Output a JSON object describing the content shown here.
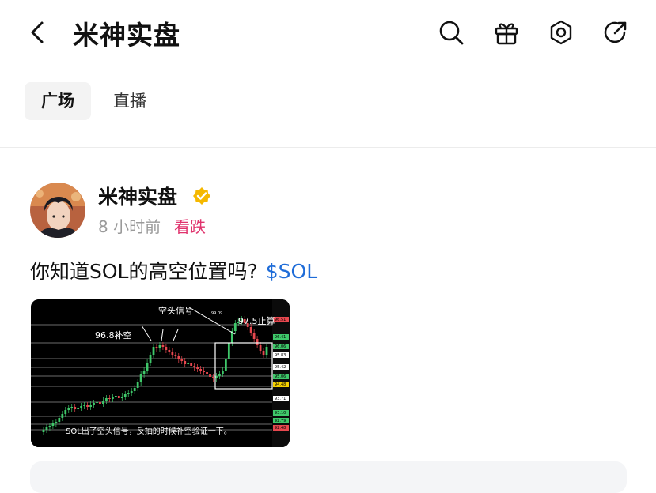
{
  "header": {
    "title": "米神实盘",
    "icons": [
      "back-arrow-icon",
      "search-icon",
      "gift-icon",
      "settings-hexagon-icon",
      "share-icon"
    ]
  },
  "tabs": [
    {
      "label": "广场",
      "active": true
    },
    {
      "label": "直播",
      "active": false
    }
  ],
  "post": {
    "author": "米神实盘",
    "verified": true,
    "time": "8 小时前",
    "sentiment": "看跌",
    "text": "你知道SOL的高空位置吗?",
    "ticker": "$SOL",
    "image": {
      "annotations": {
        "signal": "空头信号",
        "entry": "96.8补空",
        "stop": "97.5止算",
        "peak": "99.09"
      },
      "caption": "SOL出了空头信号，反抽的时候补空验证一下。",
      "price_labels": [
        "96.51",
        "96.41",
        "96.06",
        "95.83",
        "95.42",
        "95.06",
        "94.48",
        "93.71",
        "93.10",
        "92.79",
        "92.48"
      ]
    }
  },
  "colors": {
    "accent_blue": "#1e6cd8",
    "bearish_pink": "#e0336d",
    "verified_gold": "#f5b800"
  }
}
